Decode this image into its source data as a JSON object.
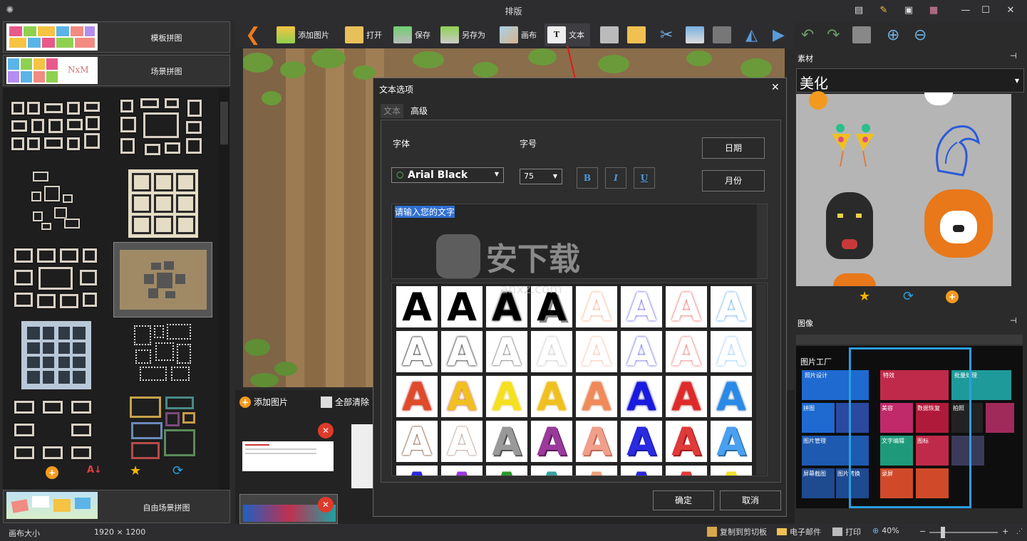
{
  "window": {
    "title": "排版"
  },
  "left_panel": {
    "tab_template": "模板拼图",
    "tab_scene": "场景拼图",
    "tab_free": "自由场景拼图",
    "scene_logo": "NxM"
  },
  "toolbar": {
    "add_image": "添加图片",
    "open": "打开",
    "save": "保存",
    "save_as": "另存为",
    "canvas": "画布",
    "text": "文本"
  },
  "strip": {
    "add_image": "添加图片",
    "clear_all": "全部清除"
  },
  "dialog": {
    "title": "文本选项",
    "tab_text": "文本",
    "tab_advanced": "高级",
    "font_label": "字体",
    "size_label": "字号",
    "font_value": "Arial Black",
    "size_value": "75",
    "bold": "B",
    "italic": "I",
    "underline": "U",
    "date_button": "日期",
    "month_button": "月份",
    "text_value": "请输入您的文字",
    "ok": "确定",
    "cancel": "取消",
    "glyph": "A"
  },
  "right_panel": {
    "materials_title": "素材",
    "category": "美化",
    "images_title": "图像",
    "preview_title": "图片工厂",
    "preview_tiles": [
      "照片设计",
      "特效",
      "批量处理",
      "拼图",
      "美容",
      "数据恢复",
      "拍照",
      "图片管理",
      "文字编辑",
      "图标",
      "屏幕截图",
      "图片转换",
      "录屏"
    ]
  },
  "watermark": {
    "text": "安下载",
    "sub": "anxz.com"
  },
  "status": {
    "canvas_size_label": "画布大小",
    "canvas_size_value": "1920 × 1200",
    "copy": "复制到剪切板",
    "email": "电子邮件",
    "print": "打印",
    "zoom": "40%"
  }
}
